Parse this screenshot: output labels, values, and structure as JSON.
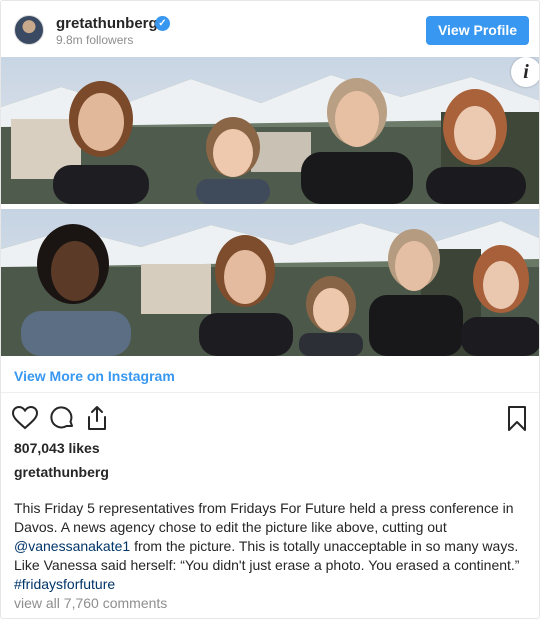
{
  "header": {
    "username": "gretathunberg",
    "followers": "9.8m followers",
    "view_profile_label": "View Profile",
    "verified_glyph": "✓"
  },
  "media": {
    "info_glyph": "i",
    "top_photo_people": 4,
    "bottom_photo_people": 5
  },
  "links": {
    "view_more": "View More on Instagram"
  },
  "actions": {
    "icons": [
      "heart-icon",
      "comment-icon",
      "share-icon",
      "bookmark-icon"
    ]
  },
  "post": {
    "likes": "807,043 likes",
    "author": "gretathunberg",
    "caption_part1": "This Friday 5 representatives from Fridays For Future held a press conference in Davos. A news agency chose to edit the picture like above, cutting out ",
    "mention": "@vanessanakate1",
    "caption_part2": " from the picture. This is totally unacceptable in so many ways. Like Vanessa said herself: “You didn't just erase a photo. You erased a continent.” ",
    "hashtag": "#fridaysforfuture",
    "view_comments": "view all 7,760 comments"
  },
  "colors": {
    "accent": "#3897f0",
    "link": "#003569",
    "muted": "#8e8e8e",
    "text": "#262626"
  }
}
